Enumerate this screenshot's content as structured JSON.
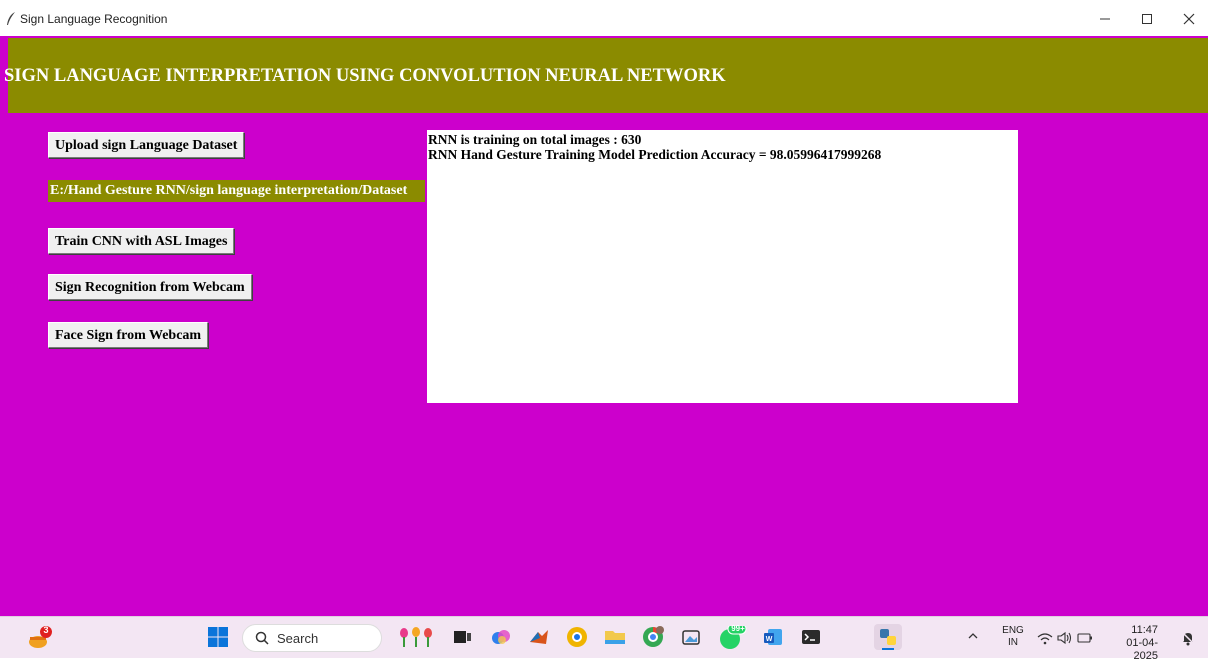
{
  "window": {
    "title": "Sign Language Recognition"
  },
  "header": {
    "title": "SIGN LANGUAGE INTERPRETATION USING CONVOLUTION NEURAL NETWORK"
  },
  "buttons": {
    "upload": "Upload sign Language Dataset",
    "train": "Train CNN with ASL Images",
    "webcam": "Sign Recognition from Webcam",
    "face": "Face Sign from Webcam"
  },
  "dataset_path": "E:/Hand Gesture RNN/sign language interpretation/Dataset",
  "output": {
    "lines": [
      "RNN is training on total images : 630",
      "RNN Hand Gesture Training Model Prediction Accuracy = 98.05996417999268"
    ]
  },
  "taskbar": {
    "notification_badge": "3",
    "search_placeholder": "Search",
    "whatsapp_badge": "99+",
    "language": "ENG",
    "region": "IN",
    "time": "11:47",
    "date": "01-04-2025"
  },
  "colors": {
    "app_background": "#cc00cc",
    "header_background": "#8b8b00",
    "header_text": "#ffffff",
    "output_background": "#ffffff"
  },
  "icons": {
    "app": "feather-icon",
    "minimize": "minimize-icon",
    "maximize": "maximize-icon",
    "close": "close-icon"
  }
}
